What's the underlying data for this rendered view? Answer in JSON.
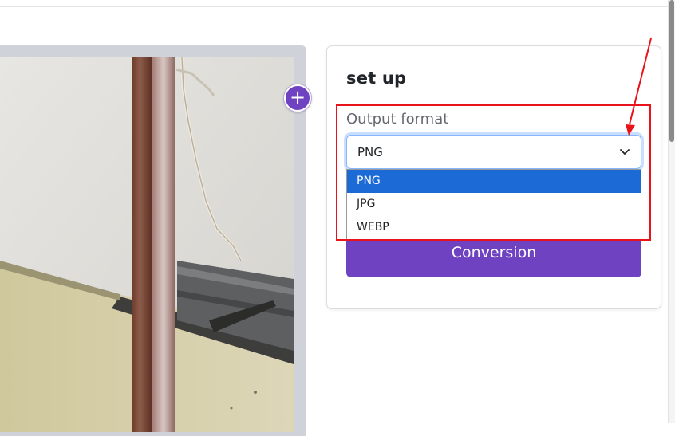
{
  "settings": {
    "title": "set up",
    "output_format_label": "Output format",
    "selected_format": "PNG",
    "options": [
      "PNG",
      "JPG",
      "WEBP"
    ],
    "convert_label": "Conversion"
  },
  "add_button_symbol": "+",
  "icons": {
    "add": "plus-icon",
    "select": "chevron-down-icon"
  },
  "colors": {
    "accent": "#6f42c1",
    "highlight_option": "#1c6ad6",
    "annotation": "#e8131b"
  }
}
